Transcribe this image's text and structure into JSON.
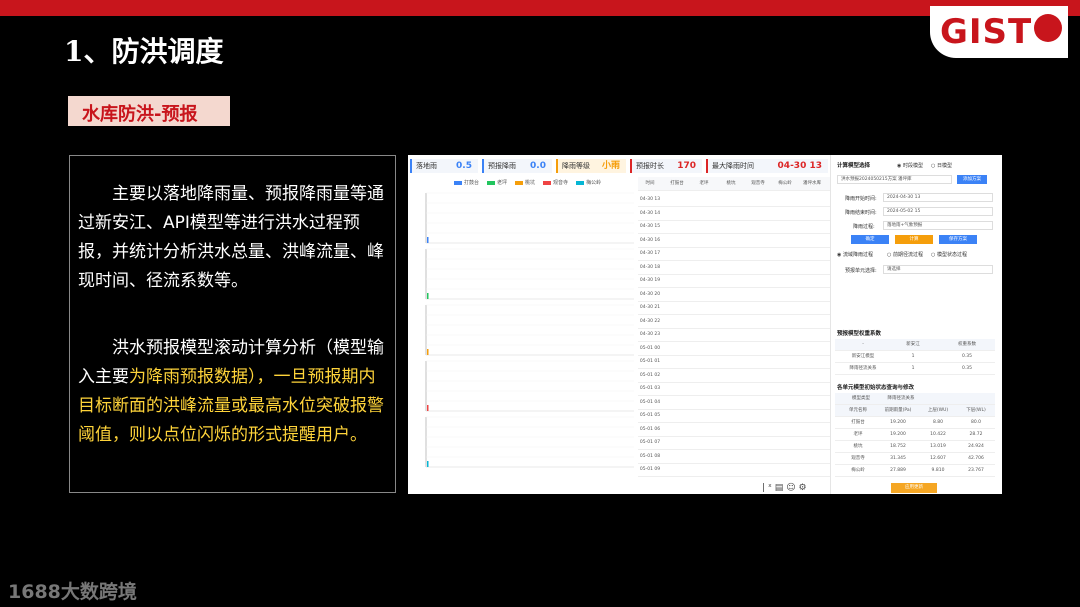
{
  "slide": {
    "title": "1、防洪调度",
    "subtitle": "水库防洪-预报",
    "logo": "GIST",
    "para1": "主要以落地降雨量、预报降雨量等通过新安江、API模型等进行洪水过程预报，并统计分析洪水总量、洪峰流量、峰现时间、径流系数等。",
    "para2_a": "洪水预报模型滚动计算分析（模型输入主要",
    "para2_hl1": "为降雨预报数据），一旦预报期内目标断面的洪峰流量或最高水位突破报警阈值，则以点位闪烁的形式提醒用户。",
    "footer": "1688大数跨境",
    "colors": {
      "accent": "#c8151c",
      "highlight": "#ffd43a"
    }
  },
  "app": {
    "stats": [
      {
        "label": "落地雨",
        "value": "0.5",
        "color": "#3b82f6"
      },
      {
        "label": "预报降雨",
        "value": "0.0",
        "color": "#3b82f6"
      },
      {
        "label": "降雨等级",
        "value": "小雨",
        "color": "#f59e0b"
      },
      {
        "label": "预报时长",
        "value": "170",
        "color": "#dc2626"
      },
      {
        "label": "最大降雨时间",
        "value": "04-30 13",
        "color": "#dc2626"
      }
    ],
    "legend": [
      "打鼓台",
      "老坪",
      "桃坑",
      "观音寺",
      "梅公岭"
    ],
    "legend_colors": [
      "#3b82f6",
      "#22c55e",
      "#f59e0b",
      "#ef4444",
      "#06b6d4"
    ],
    "table": {
      "headers": [
        "时间",
        "打鼓台",
        "老坪",
        "桃坑",
        "观音寺",
        "梅公岭",
        "潘坪水库"
      ],
      "times": [
        "04-30 13",
        "04-30 14",
        "04-30 15",
        "04-30 16",
        "04-30 17",
        "04-30 18",
        "04-30 19",
        "04-30 20",
        "04-30 21",
        "04-30 22",
        "04-30 23",
        "05-01 00",
        "05-01 01",
        "05-01 02",
        "05-01 03",
        "05-01 04",
        "05-01 05",
        "05-01 06",
        "05-01 07",
        "05-01 08",
        "05-01 09"
      ]
    },
    "panel": {
      "calc_select": "计算模型选择",
      "opt1": "时段模型",
      "opt2": "日模型",
      "scheme": "洪水预报2024050215方案 潘坪库",
      "scheme_btn": "添加方案",
      "start_label": "降雨开始时间:",
      "start_value": "2024-04-30 13",
      "end_label": "降雨结束时间:",
      "end_value": "2024-05-02 15",
      "process_label": "降雨过程:",
      "process_value": "落地雨+气象预报",
      "btn_ok": "确定",
      "btn_calc": "计算",
      "btn_save": "保存方案",
      "radio1": "流域降雨过程",
      "radio2": "前期径流过程",
      "radio3": "模型状态过程",
      "unit_label": "预报单元选择:",
      "unit_placeholder": "请选择",
      "weight_title": "预报模型权重系数",
      "weight_headers": [
        "-",
        "新安江",
        "权重系数"
      ],
      "weight_rows": [
        [
          "新安江模型",
          "1",
          "0.35"
        ],
        [
          "降雨径流关系",
          "1",
          "0.35"
        ]
      ],
      "init_title": "各单元模型初始状态查询与修改",
      "init_headers": [
        "模型类型",
        "降雨径流关系"
      ],
      "init_sub": [
        "单元名称",
        "前期雨量(Pa)",
        "上层(WU)",
        "下层(WL)"
      ],
      "init_rows": [
        [
          "打鼓台",
          "19.200",
          "8.80",
          "80.0"
        ],
        [
          "老坪",
          "19.200",
          "10.422",
          "28.72"
        ],
        [
          "桃坑",
          "18.752",
          "13.019",
          "24.924"
        ],
        [
          "观音寺",
          "31.345",
          "12.607",
          "42.706"
        ],
        [
          "梅公岭",
          "27.889",
          "9.810",
          "23.767"
        ]
      ],
      "apply_btn": "应用更新"
    }
  }
}
